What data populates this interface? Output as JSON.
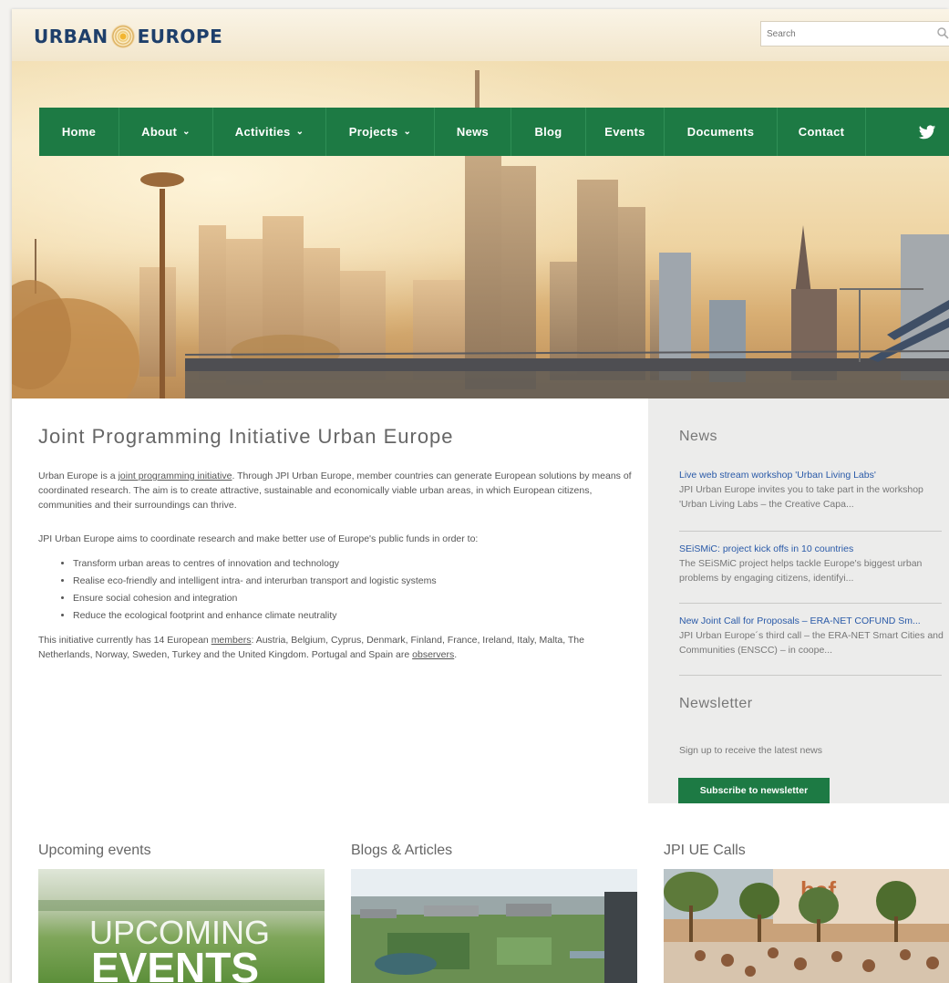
{
  "header": {
    "logo_left": "URBAN",
    "logo_right": "EUROPE",
    "search_placeholder": "Search"
  },
  "nav": {
    "items": [
      {
        "label": "Home",
        "dropdown": false
      },
      {
        "label": "About",
        "dropdown": true
      },
      {
        "label": "Activities",
        "dropdown": true
      },
      {
        "label": "Projects",
        "dropdown": true
      },
      {
        "label": "News",
        "dropdown": false
      },
      {
        "label": "Blog",
        "dropdown": false
      },
      {
        "label": "Events",
        "dropdown": false
      },
      {
        "label": "Documents",
        "dropdown": false
      },
      {
        "label": "Contact",
        "dropdown": false
      }
    ],
    "chevron": "⌄"
  },
  "main": {
    "title": "Joint Programming Initiative Urban Europe",
    "intro": {
      "before_link": "Urban Europe is a ",
      "link": "joint programming initiative",
      "after_link": ". Through JPI Urban Europe, member countries can generate European solutions by means of coordinated research. The aim is to create attractive, sustainable and economically viable urban areas, in which European citizens, communities and their surroundings can thrive."
    },
    "aims_intro": "JPI Urban Europe aims to coordinate research and make better use of Europe's public funds in order to:",
    "aims": [
      "Transform urban areas to centres of innovation and technology",
      "Realise eco-friendly and intelligent intra- and interurban transport and logistic systems",
      "Ensure social cohesion and integration",
      "Reduce the ecological footprint and enhance climate neutrality"
    ],
    "members": {
      "before_link": "This initiative currently has 14 European ",
      "link": "members",
      "middle": ": Austria, Belgium, Cyprus, Denmark, Finland, France, Ireland, Italy, Malta, The Netherlands, Norway, Sweden, Turkey and the United Kingdom. Portugal and Spain are ",
      "link2": "observers",
      "after": "."
    }
  },
  "sidebar": {
    "news_heading": "News",
    "news": [
      {
        "title": "Live web stream workshop 'Urban Living Labs'",
        "text": "JPI Urban Europe invites you to take part in the workshop 'Urban Living Labs – the Creative Capa..."
      },
      {
        "title": "SEiSMiC: project kick offs in 10 countries",
        "text": "The SEiSMiC project helps tackle Europe's biggest urban problems by engaging citizens, identifyi..."
      },
      {
        "title": "New Joint Call for Proposals – ERA-NET COFUND Sm...",
        "text": "JPI Urban Europe´s third call – the ERA-NET Smart Cities and Communities (ENSCC) – in coope..."
      }
    ],
    "newsletter_heading": "Newsletter",
    "newsletter_text": "Sign up to receive the latest news",
    "subscribe_label": "Subscribe to newsletter"
  },
  "bottom": {
    "sections": [
      {
        "heading": "Upcoming events",
        "image_text_1": "UPCOMING",
        "image_text_2": "EVENTS"
      },
      {
        "heading": "Blogs & Articles"
      },
      {
        "heading": "JPI UE Calls",
        "image_text": "baf"
      }
    ]
  },
  "colors": {
    "nav_green": "#1d7a44",
    "link_blue": "#2a5aa8",
    "logo_blue": "#1e3f6b"
  }
}
